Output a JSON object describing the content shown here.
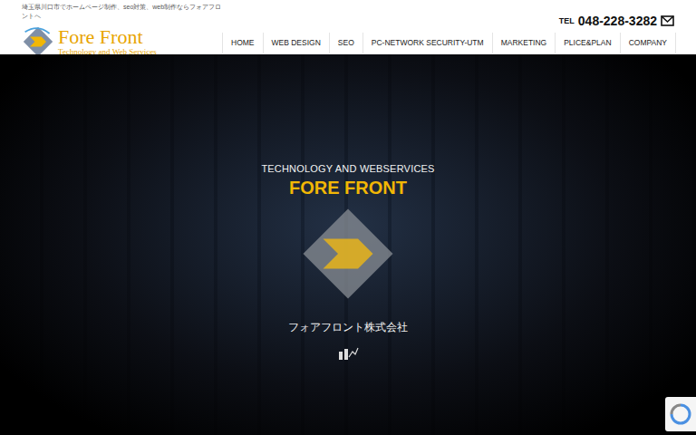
{
  "header": {
    "tagline": "埼玉県川口市でホームページ制作、seo対策、web制作ならフォアフロントへ",
    "logo": {
      "title": "Fore Front",
      "subtitle": "Technology and Web Services"
    },
    "contact": {
      "tel_label": "TEL",
      "phone": "048-228-3282"
    }
  },
  "nav": [
    {
      "label": "HOME",
      "selected": false
    },
    {
      "label": "WEB DESIGN",
      "selected": false
    },
    {
      "label": "SEO",
      "selected": false
    },
    {
      "label": "PC-NETWORK SECURITY-UTM",
      "selected": false
    },
    {
      "label": "MARKETING",
      "selected": false
    },
    {
      "label": "PLICE&PLAN",
      "selected": false
    },
    {
      "label": "COMPANY",
      "selected": false
    }
  ],
  "hero": {
    "kicker": "TECHNOLOGY AND WEBSERVICES",
    "title": "FORE FRONT",
    "company": "フォアフロント株式会社"
  }
}
